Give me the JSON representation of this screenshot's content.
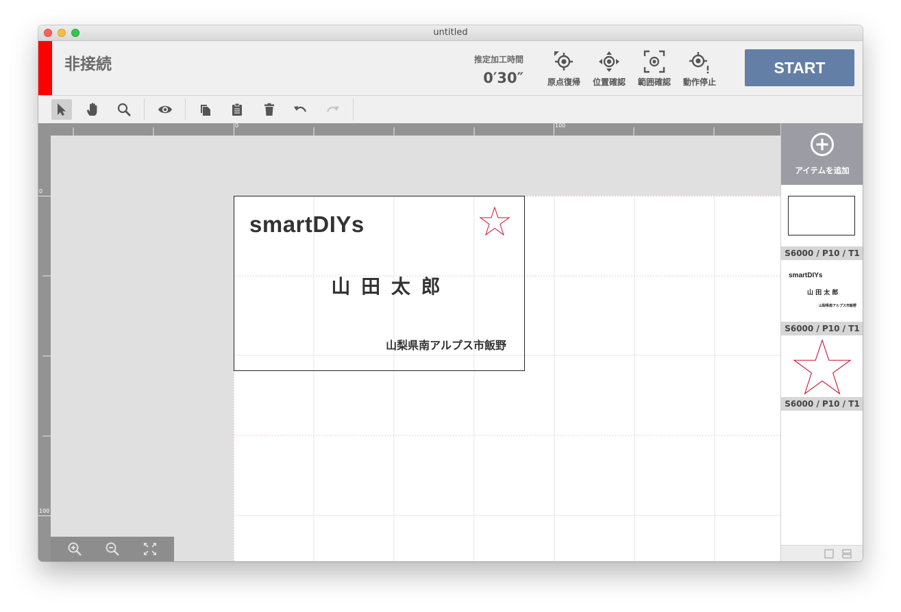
{
  "window": {
    "title": "untitled"
  },
  "header": {
    "status": "非接続",
    "time_label": "推定加工時間",
    "time_value": "0′30″",
    "buttons": [
      {
        "label": "原点復帰",
        "icon": "origin-return-icon"
      },
      {
        "label": "位置確認",
        "icon": "position-check-icon"
      },
      {
        "label": "範囲確認",
        "icon": "range-check-icon"
      },
      {
        "label": "動作停止",
        "icon": "stop-operation-icon"
      }
    ],
    "start_label": "START",
    "status_color": "#ff0000",
    "start_color": "#647fa6"
  },
  "toolbar": {
    "tools": [
      "select-arrow-icon",
      "hand-icon",
      "search-icon",
      "eye-icon",
      "copy-icon",
      "paste-icon",
      "trash-icon",
      "undo-icon",
      "redo-icon"
    ]
  },
  "rulers": {
    "top_labels": [
      "0",
      "100"
    ],
    "left_labels": [
      "0",
      "100"
    ]
  },
  "card": {
    "brand": "smartDIYs",
    "name": "山 田 太 郎",
    "address": "山梨県南アルプス市飯野"
  },
  "panel": {
    "add_label": "アイテムを追加",
    "items": [
      {
        "label": "S6000 / P10 / T1",
        "kind": "rectangle"
      },
      {
        "label": "S6000 / P10 / T1",
        "kind": "text",
        "brand": "smartDIYs",
        "name": "山 田 太 郎",
        "address": "山梨県南アルプス市飯野"
      },
      {
        "label": "S6000 / P10 / T1",
        "kind": "star"
      }
    ]
  }
}
